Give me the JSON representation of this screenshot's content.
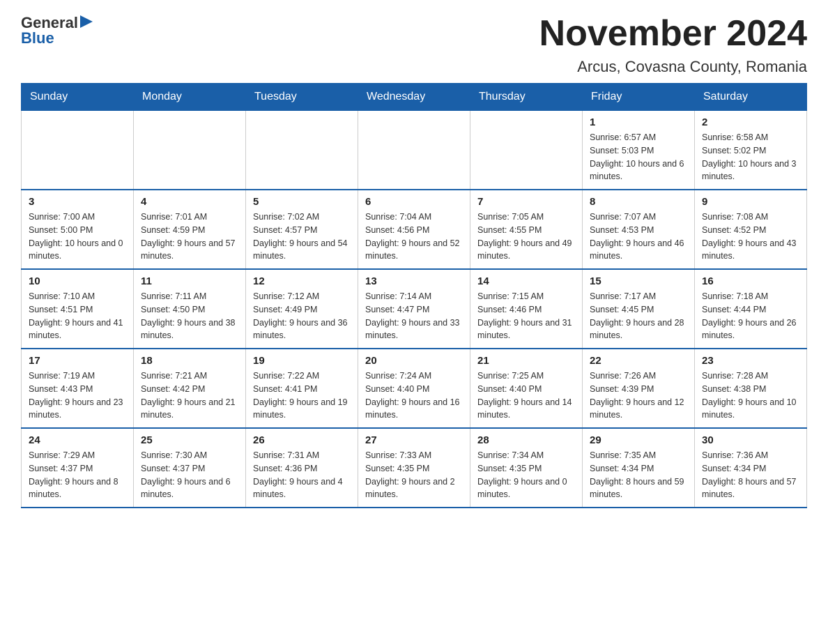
{
  "logo": {
    "general": "General",
    "arrow": "▶",
    "blue": "Blue"
  },
  "title": "November 2024",
  "subtitle": "Arcus, Covasna County, Romania",
  "weekdays": [
    "Sunday",
    "Monday",
    "Tuesday",
    "Wednesday",
    "Thursday",
    "Friday",
    "Saturday"
  ],
  "weeks": [
    [
      {
        "day": "",
        "info": ""
      },
      {
        "day": "",
        "info": ""
      },
      {
        "day": "",
        "info": ""
      },
      {
        "day": "",
        "info": ""
      },
      {
        "day": "",
        "info": ""
      },
      {
        "day": "1",
        "info": "Sunrise: 6:57 AM\nSunset: 5:03 PM\nDaylight: 10 hours and 6 minutes."
      },
      {
        "day": "2",
        "info": "Sunrise: 6:58 AM\nSunset: 5:02 PM\nDaylight: 10 hours and 3 minutes."
      }
    ],
    [
      {
        "day": "3",
        "info": "Sunrise: 7:00 AM\nSunset: 5:00 PM\nDaylight: 10 hours and 0 minutes."
      },
      {
        "day": "4",
        "info": "Sunrise: 7:01 AM\nSunset: 4:59 PM\nDaylight: 9 hours and 57 minutes."
      },
      {
        "day": "5",
        "info": "Sunrise: 7:02 AM\nSunset: 4:57 PM\nDaylight: 9 hours and 54 minutes."
      },
      {
        "day": "6",
        "info": "Sunrise: 7:04 AM\nSunset: 4:56 PM\nDaylight: 9 hours and 52 minutes."
      },
      {
        "day": "7",
        "info": "Sunrise: 7:05 AM\nSunset: 4:55 PM\nDaylight: 9 hours and 49 minutes."
      },
      {
        "day": "8",
        "info": "Sunrise: 7:07 AM\nSunset: 4:53 PM\nDaylight: 9 hours and 46 minutes."
      },
      {
        "day": "9",
        "info": "Sunrise: 7:08 AM\nSunset: 4:52 PM\nDaylight: 9 hours and 43 minutes."
      }
    ],
    [
      {
        "day": "10",
        "info": "Sunrise: 7:10 AM\nSunset: 4:51 PM\nDaylight: 9 hours and 41 minutes."
      },
      {
        "day": "11",
        "info": "Sunrise: 7:11 AM\nSunset: 4:50 PM\nDaylight: 9 hours and 38 minutes."
      },
      {
        "day": "12",
        "info": "Sunrise: 7:12 AM\nSunset: 4:49 PM\nDaylight: 9 hours and 36 minutes."
      },
      {
        "day": "13",
        "info": "Sunrise: 7:14 AM\nSunset: 4:47 PM\nDaylight: 9 hours and 33 minutes."
      },
      {
        "day": "14",
        "info": "Sunrise: 7:15 AM\nSunset: 4:46 PM\nDaylight: 9 hours and 31 minutes."
      },
      {
        "day": "15",
        "info": "Sunrise: 7:17 AM\nSunset: 4:45 PM\nDaylight: 9 hours and 28 minutes."
      },
      {
        "day": "16",
        "info": "Sunrise: 7:18 AM\nSunset: 4:44 PM\nDaylight: 9 hours and 26 minutes."
      }
    ],
    [
      {
        "day": "17",
        "info": "Sunrise: 7:19 AM\nSunset: 4:43 PM\nDaylight: 9 hours and 23 minutes."
      },
      {
        "day": "18",
        "info": "Sunrise: 7:21 AM\nSunset: 4:42 PM\nDaylight: 9 hours and 21 minutes."
      },
      {
        "day": "19",
        "info": "Sunrise: 7:22 AM\nSunset: 4:41 PM\nDaylight: 9 hours and 19 minutes."
      },
      {
        "day": "20",
        "info": "Sunrise: 7:24 AM\nSunset: 4:40 PM\nDaylight: 9 hours and 16 minutes."
      },
      {
        "day": "21",
        "info": "Sunrise: 7:25 AM\nSunset: 4:40 PM\nDaylight: 9 hours and 14 minutes."
      },
      {
        "day": "22",
        "info": "Sunrise: 7:26 AM\nSunset: 4:39 PM\nDaylight: 9 hours and 12 minutes."
      },
      {
        "day": "23",
        "info": "Sunrise: 7:28 AM\nSunset: 4:38 PM\nDaylight: 9 hours and 10 minutes."
      }
    ],
    [
      {
        "day": "24",
        "info": "Sunrise: 7:29 AM\nSunset: 4:37 PM\nDaylight: 9 hours and 8 minutes."
      },
      {
        "day": "25",
        "info": "Sunrise: 7:30 AM\nSunset: 4:37 PM\nDaylight: 9 hours and 6 minutes."
      },
      {
        "day": "26",
        "info": "Sunrise: 7:31 AM\nSunset: 4:36 PM\nDaylight: 9 hours and 4 minutes."
      },
      {
        "day": "27",
        "info": "Sunrise: 7:33 AM\nSunset: 4:35 PM\nDaylight: 9 hours and 2 minutes."
      },
      {
        "day": "28",
        "info": "Sunrise: 7:34 AM\nSunset: 4:35 PM\nDaylight: 9 hours and 0 minutes."
      },
      {
        "day": "29",
        "info": "Sunrise: 7:35 AM\nSunset: 4:34 PM\nDaylight: 8 hours and 59 minutes."
      },
      {
        "day": "30",
        "info": "Sunrise: 7:36 AM\nSunset: 4:34 PM\nDaylight: 8 hours and 57 minutes."
      }
    ]
  ]
}
